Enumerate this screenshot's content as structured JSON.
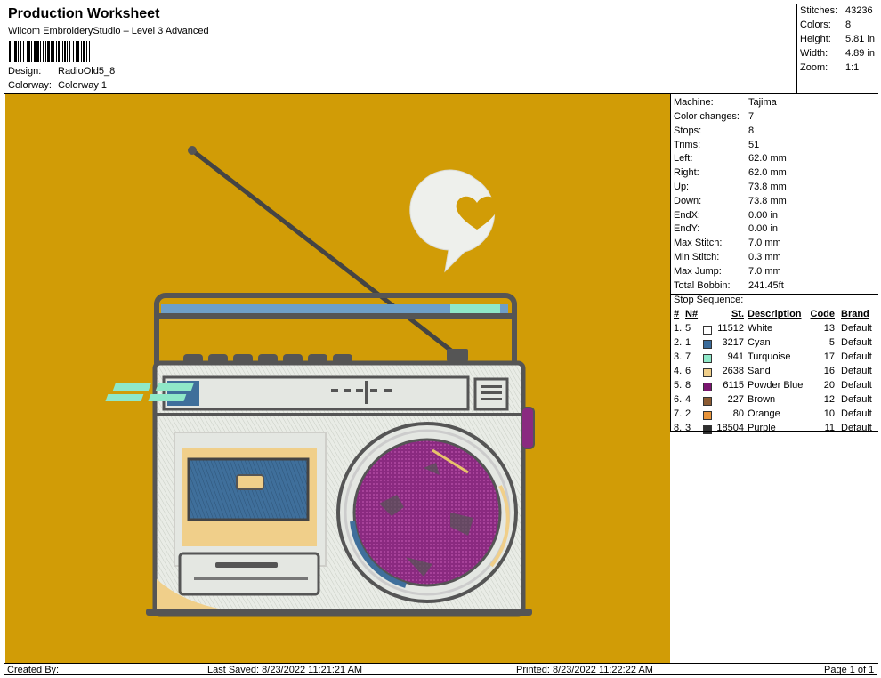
{
  "header": {
    "title": "Production Worksheet",
    "subtitle": "Wilcom EmbroideryStudio – Level 3 Advanced",
    "design_label": "Design:",
    "design_value": "RadioOld5_8",
    "colorway_label": "Colorway:",
    "colorway_value": "Colorway 1"
  },
  "stats": [
    {
      "label": "Stitches:",
      "value": "43236"
    },
    {
      "label": "Colors:",
      "value": "8"
    },
    {
      "label": "Height:",
      "value": "5.81 in"
    },
    {
      "label": "Width:",
      "value": "4.89 in"
    },
    {
      "label": "Zoom:",
      "value": "1:1"
    }
  ],
  "machine_info": [
    {
      "label": "Machine:",
      "value": "Tajima"
    },
    {
      "label": "Color changes:",
      "value": "7"
    },
    {
      "label": "Stops:",
      "value": "8"
    },
    {
      "label": "Trims:",
      "value": "51"
    },
    {
      "label": "Left:",
      "value": "62.0 mm"
    },
    {
      "label": "Right:",
      "value": "62.0 mm"
    },
    {
      "label": "Up:",
      "value": "73.8 mm"
    },
    {
      "label": "Down:",
      "value": "73.8 mm"
    },
    {
      "label": "EndX:",
      "value": "0.00 in"
    },
    {
      "label": "EndY:",
      "value": "0.00 in"
    },
    {
      "label": "Max Stitch:",
      "value": "7.0 mm"
    },
    {
      "label": "Min Stitch:",
      "value": "0.3 mm"
    },
    {
      "label": "Max Jump:",
      "value": "7.0 mm"
    },
    {
      "label": "Total Bobbin:",
      "value": "241.45ft"
    }
  ],
  "stop_sequence": {
    "title": "Stop Sequence:",
    "headers": {
      "idx": "#",
      "n": "N#",
      "st": "St.",
      "desc": "Description",
      "code": "Code",
      "brand": "Brand"
    },
    "rows": [
      {
        "idx": "1.",
        "n": "5",
        "color": "#ffffff",
        "st": "11512",
        "desc": "White",
        "code": "13",
        "brand": "Default"
      },
      {
        "idx": "2.",
        "n": "1",
        "color": "#3a6b9a",
        "st": "3217",
        "desc": "Cyan",
        "code": "5",
        "brand": "Default"
      },
      {
        "idx": "3.",
        "n": "7",
        "color": "#8fe8c8",
        "st": "941",
        "desc": "Turquoise",
        "code": "17",
        "brand": "Default"
      },
      {
        "idx": "4.",
        "n": "6",
        "color": "#f0cf8a",
        "st": "2638",
        "desc": "Sand",
        "code": "16",
        "brand": "Default"
      },
      {
        "idx": "5.",
        "n": "8",
        "color": "#7a1670",
        "st": "6115",
        "desc": "Powder Blue",
        "code": "20",
        "brand": "Default"
      },
      {
        "idx": "6.",
        "n": "4",
        "color": "#8b5a32",
        "st": "227",
        "desc": "Brown",
        "code": "12",
        "brand": "Default"
      },
      {
        "idx": "7.",
        "n": "2",
        "color": "#e8943a",
        "st": "80",
        "desc": "Orange",
        "code": "10",
        "brand": "Default"
      },
      {
        "idx": "8.",
        "n": "3",
        "color": "#2f2f2f",
        "st": "18504",
        "desc": "Purple",
        "code": "11",
        "brand": "Default"
      }
    ]
  },
  "footer": {
    "created_by": "Created By:",
    "last_saved": "Last Saved: 8/23/2022 11:21:21 AM",
    "printed": "Printed: 8/23/2022 11:22:22 AM",
    "page": "Page 1 of 1"
  },
  "design_colors": {
    "background": "#d19c06"
  }
}
